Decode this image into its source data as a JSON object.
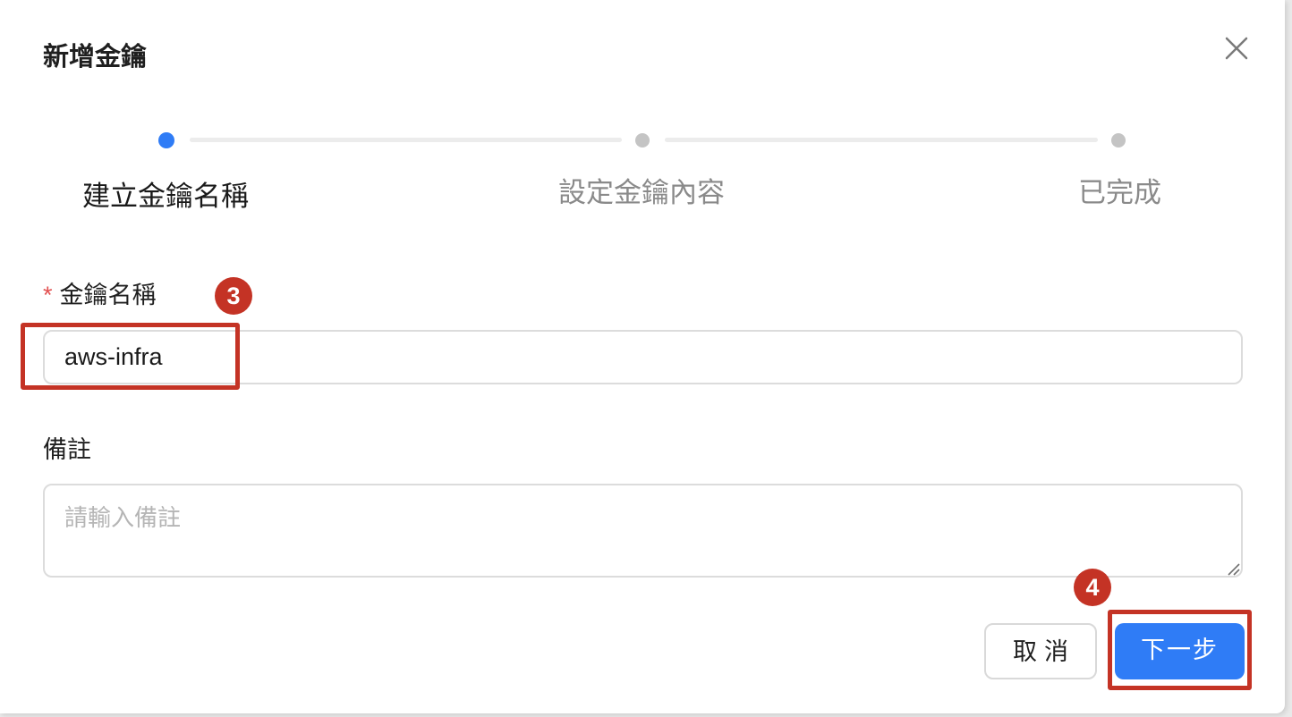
{
  "dialog": {
    "title": "新增金鑰",
    "close_icon": "close-icon"
  },
  "steps": [
    {
      "label": "建立金鑰名稱",
      "state": "active"
    },
    {
      "label": "設定金鑰內容",
      "state": "pending"
    },
    {
      "label": "已完成",
      "state": "pending"
    }
  ],
  "form": {
    "name": {
      "required_mark": "*",
      "label": "金鑰名稱",
      "value": "aws-infra"
    },
    "note": {
      "label": "備註",
      "placeholder": "請輸入備註",
      "value": ""
    }
  },
  "annotations": {
    "badge_name": "3",
    "badge_next": "4"
  },
  "actions": {
    "cancel_label": "取消",
    "next_label": "下一步"
  },
  "colors": {
    "accent": "#2f7cf6",
    "annotation": "#c43325",
    "required": "#e25050"
  }
}
